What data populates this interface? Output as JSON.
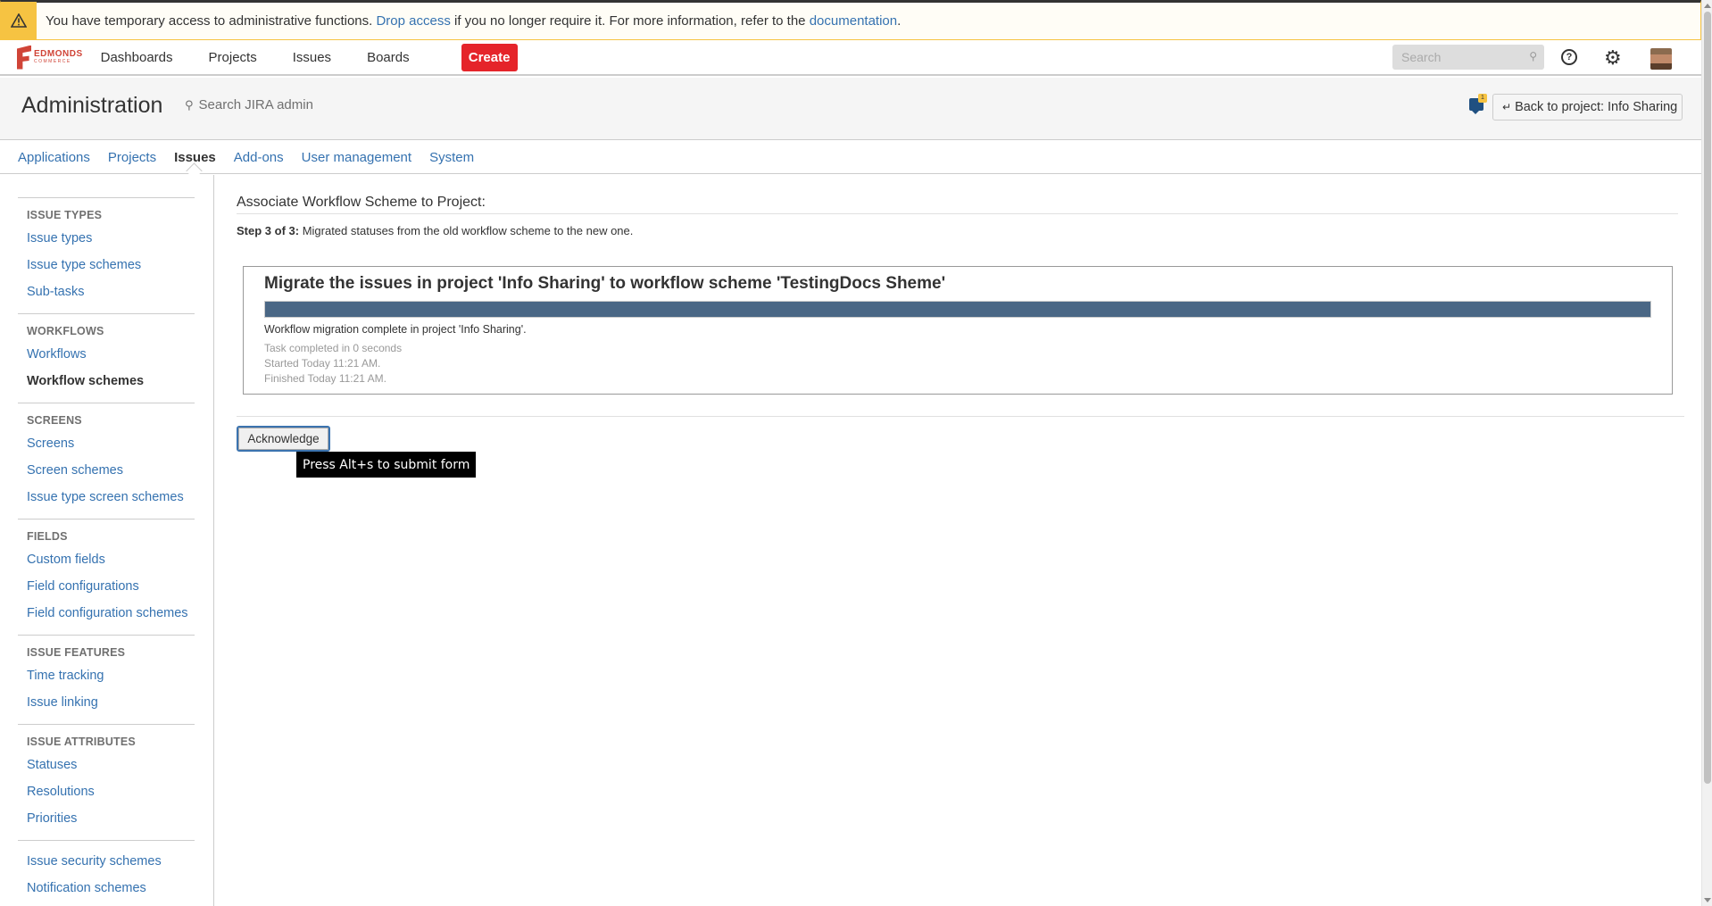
{
  "banner": {
    "text_before": "You have temporary access to administrative functions. ",
    "drop_link": "Drop access",
    "text_middle": " if you no longer require it. For more information, refer to the ",
    "doc_link": "documentation",
    "text_after": "."
  },
  "topnav": {
    "logo_line1": "EDMONDS",
    "logo_line2": "COMMERCE",
    "items": [
      "Dashboards",
      "Projects",
      "Issues",
      "Boards"
    ],
    "create_label": "Create",
    "search_placeholder": "Search"
  },
  "admin": {
    "title": "Administration",
    "search_placeholder": "Search JIRA admin",
    "notification_count": "1",
    "back_button": "Back to project: Info Sharing"
  },
  "tabs": [
    {
      "label": "Applications",
      "active": false
    },
    {
      "label": "Projects",
      "active": false
    },
    {
      "label": "Issues",
      "active": true
    },
    {
      "label": "Add-ons",
      "active": false
    },
    {
      "label": "User management",
      "active": false
    },
    {
      "label": "System",
      "active": false
    }
  ],
  "sidebar": {
    "groups": [
      {
        "heading": "ISSUE TYPES",
        "items": [
          {
            "label": "Issue types"
          },
          {
            "label": "Issue type schemes"
          },
          {
            "label": "Sub-tasks"
          }
        ]
      },
      {
        "heading": "WORKFLOWS",
        "items": [
          {
            "label": "Workflows"
          },
          {
            "label": "Workflow schemes",
            "active": true
          }
        ]
      },
      {
        "heading": "SCREENS",
        "items": [
          {
            "label": "Screens"
          },
          {
            "label": "Screen schemes"
          },
          {
            "label": "Issue type screen schemes"
          }
        ]
      },
      {
        "heading": "FIELDS",
        "items": [
          {
            "label": "Custom fields"
          },
          {
            "label": "Field configurations"
          },
          {
            "label": "Field configuration schemes"
          }
        ]
      },
      {
        "heading": "ISSUE FEATURES",
        "items": [
          {
            "label": "Time tracking"
          },
          {
            "label": "Issue linking"
          }
        ]
      },
      {
        "heading": "ISSUE ATTRIBUTES",
        "items": [
          {
            "label": "Statuses"
          },
          {
            "label": "Resolutions"
          },
          {
            "label": "Priorities"
          }
        ]
      },
      {
        "heading": "",
        "items": [
          {
            "label": "Issue security schemes"
          },
          {
            "label": "Notification schemes"
          }
        ]
      }
    ]
  },
  "main": {
    "heading": "Associate Workflow Scheme to Project:",
    "step_label": "Step 3 of 3:",
    "step_text": " Migrated statuses from the old workflow scheme to the new one.",
    "panel": {
      "title": "Migrate the issues in project 'Info Sharing' to workflow scheme 'TestingDocs Sheme'",
      "progress_percent": 100,
      "complete_text": "Workflow migration complete in project 'Info Sharing'.",
      "task_completed": "Task completed in 0 seconds",
      "started": "Started Today 11:21 AM.",
      "finished": "Finished Today 11:21 AM."
    },
    "acknowledge_label": "Acknowledge",
    "tooltip": "Press Alt+s to submit form"
  }
}
